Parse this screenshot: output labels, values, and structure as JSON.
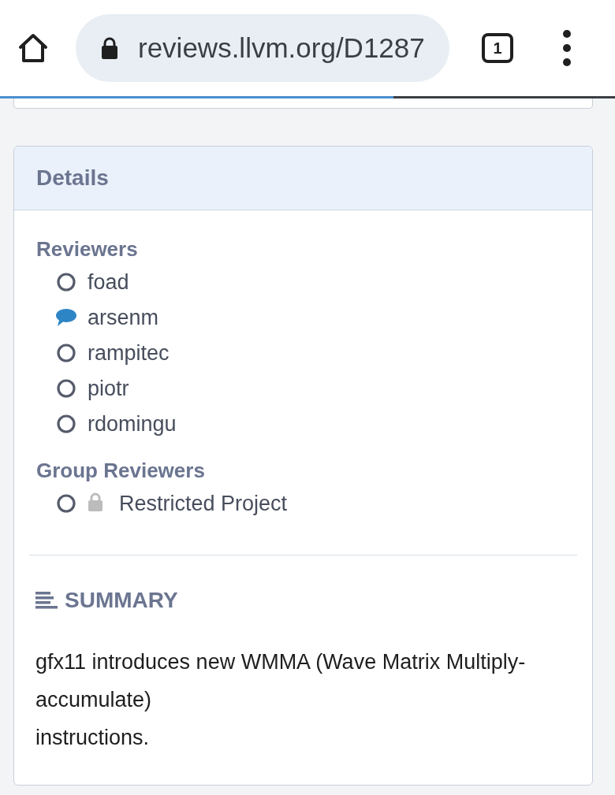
{
  "browser": {
    "url": "reviews.llvm.org/D1287",
    "tab_count": "1",
    "load_progress": {
      "level": 0.64
    }
  },
  "details": {
    "title": "Details",
    "sections": [
      {
        "heading": "Reviewers",
        "items": [
          {
            "name": "foad",
            "kind": "pending",
            "restricted": false
          },
          {
            "name": "arsenm",
            "kind": "commented",
            "restricted": false
          },
          {
            "name": "rampitec",
            "kind": "pending",
            "restricted": false
          },
          {
            "name": "piotr",
            "kind": "pending",
            "restricted": false
          },
          {
            "name": "rdomingu",
            "kind": "pending",
            "restricted": false
          }
        ]
      },
      {
        "heading": "Group Reviewers",
        "items": [
          {
            "name": "Restricted Project",
            "kind": "pending",
            "restricted": true
          }
        ]
      }
    ]
  },
  "summary": {
    "heading": "SUMMARY",
    "text": "gfx11 introduces new WMMA (Wave Matrix Multiply-accumulate)\ninstructions."
  }
}
